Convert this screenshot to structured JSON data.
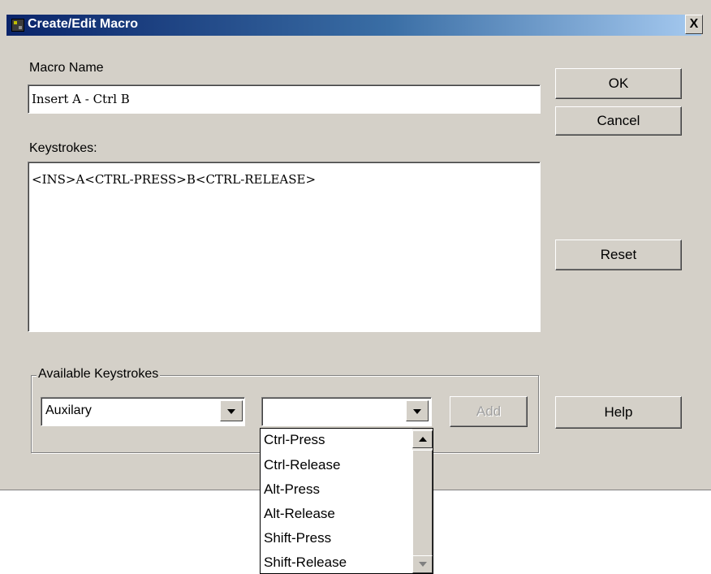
{
  "window": {
    "title": "Create/Edit Macro",
    "close_glyph": "X"
  },
  "macro_name": {
    "label": "Macro Name",
    "value": "Insert A - Ctrl B"
  },
  "keystrokes": {
    "label": "Keystrokes:",
    "value": "<INS>A<CTRL-PRESS>B<CTRL-RELEASE>"
  },
  "buttons": {
    "ok": "OK",
    "cancel": "Cancel",
    "reset": "Reset",
    "help": "Help",
    "add": "Add"
  },
  "available": {
    "legend": "Available Keystrokes",
    "category_selected": "Auxilary",
    "keystroke_selected": "",
    "options": [
      "Ctrl-Press",
      "Ctrl-Release",
      "Alt-Press",
      "Alt-Release",
      "Shift-Press",
      "Shift-Release"
    ]
  },
  "icons": {
    "app": "macro-app-icon",
    "close": "close-icon",
    "dropdown": "chevron-down-icon"
  }
}
